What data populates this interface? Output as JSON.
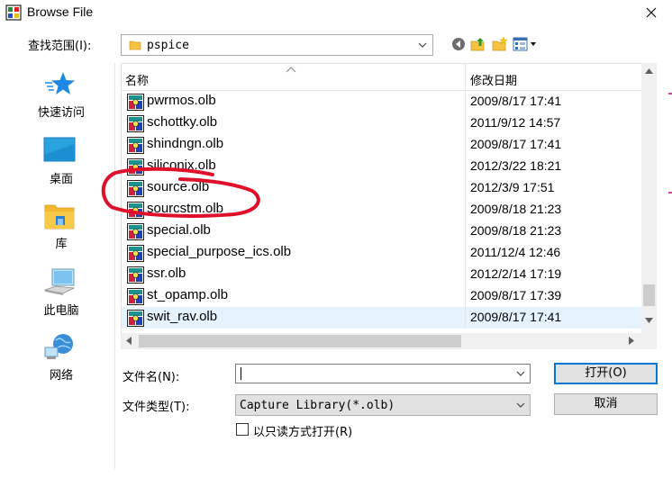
{
  "window": {
    "title": "Browse File",
    "close_icon": "close-icon"
  },
  "lookin": {
    "label": "查找范围(I):",
    "value": "pspice"
  },
  "toolbar": {
    "icons": [
      "back-icon",
      "up-folder-icon",
      "new-folder-icon",
      "view-menu-icon"
    ]
  },
  "places": [
    {
      "label": "快速访问",
      "icon": "quick-access-star-icon"
    },
    {
      "label": "桌面",
      "icon": "desktop-icon"
    },
    {
      "label": "库",
      "icon": "library-icon"
    },
    {
      "label": "此电脑",
      "icon": "computer-icon"
    },
    {
      "label": "网络",
      "icon": "network-icon"
    }
  ],
  "columns": {
    "name": "名称",
    "date": "修改日期"
  },
  "files": [
    {
      "name": "pwrmos.olb",
      "date": "2009/8/17 17:41"
    },
    {
      "name": "schottky.olb",
      "date": "2011/9/12 14:57"
    },
    {
      "name": "shindngn.olb",
      "date": "2009/8/17 17:41"
    },
    {
      "name": "siliconix.olb",
      "date": "2012/3/22 18:21"
    },
    {
      "name": "source.olb",
      "date": "2012/3/9 17:51"
    },
    {
      "name": "sourcstm.olb",
      "date": "2009/8/18 21:23"
    },
    {
      "name": "special.olb",
      "date": "2009/8/18 21:23"
    },
    {
      "name": "special_purpose_ics.olb",
      "date": "2011/12/4 12:46"
    },
    {
      "name": "ssr.olb",
      "date": "2012/2/14 17:19"
    },
    {
      "name": "st_opamp.olb",
      "date": "2009/8/17 17:39"
    },
    {
      "name": "swit_rav.olb",
      "date": "2009/8/17 17:41"
    }
  ],
  "selected_file": "swit_rav.olb",
  "filename": {
    "label": "文件名(N):",
    "value": ""
  },
  "filetype": {
    "label": "文件类型(T):",
    "value": "Capture Library(*.olb)"
  },
  "readonly": {
    "label": "以只读方式打开(R)",
    "checked": false
  },
  "buttons": {
    "open": "打开(O)",
    "cancel": "取消"
  },
  "colors": {
    "selection": "#e5f3ff",
    "accent": "#0078d7",
    "annotation": "#e0102a"
  }
}
